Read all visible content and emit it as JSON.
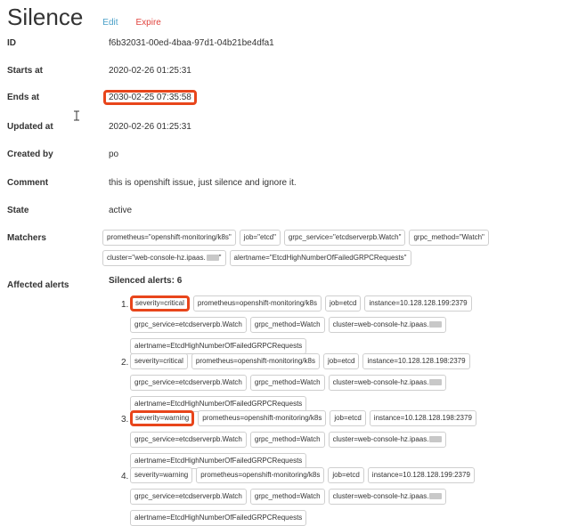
{
  "header": {
    "title": "Silence",
    "edit_label": "Edit",
    "expire_label": "Expire"
  },
  "fields": {
    "id": {
      "label": "ID",
      "value": "f6b32031-00ed-4baa-97d1-04b21be4dfa1"
    },
    "starts_at": {
      "label": "Starts at",
      "value": "2020-02-26 01:25:31"
    },
    "ends_at": {
      "label": "Ends at",
      "value": "2030-02-25 07:35:58"
    },
    "updated_at": {
      "label": "Updated at",
      "value": "2020-02-26 01:25:31"
    },
    "created_by": {
      "label": "Created by",
      "value": "po"
    },
    "comment": {
      "label": "Comment",
      "value": "this is openshift issue, just silence and ignore it."
    },
    "state": {
      "label": "State",
      "value": "active"
    },
    "matchers_label": "Matchers",
    "affected_label": "Affected alerts"
  },
  "matchers": [
    "prometheus=\"openshift-monitoring/k8s\"",
    "job=\"etcd\"",
    "grpc_service=\"etcdserverpb.Watch\"",
    "grpc_method=\"Watch\"",
    "cluster=\"web-console-hz.ipaas.",
    "alertname=\"EtcdHighNumberOfFailedGRPCRequests\""
  ],
  "silenced_title": "Silenced alerts: 6",
  "alerts": [
    {
      "num": "1.",
      "labels": [
        "severity=critical",
        "prometheus=openshift-monitoring/k8s",
        "job=etcd",
        "instance=10.128.128.199:2379",
        "grpc_service=etcdserverpb.Watch",
        "grpc_method=Watch",
        "cluster=web-console-hz.ipaas.",
        "alertname=EtcdHighNumberOfFailedGRPCRequests"
      ]
    },
    {
      "num": "2.",
      "labels": [
        "severity=critical",
        "prometheus=openshift-monitoring/k8s",
        "job=etcd",
        "instance=10.128.128.198:2379",
        "grpc_service=etcdserverpb.Watch",
        "grpc_method=Watch",
        "cluster=web-console-hz.ipaas.",
        "alertname=EtcdHighNumberOfFailedGRPCRequests"
      ]
    },
    {
      "num": "3.",
      "labels": [
        "severity=warning",
        "prometheus=openshift-monitoring/k8s",
        "job=etcd",
        "instance=10.128.128.198:2379",
        "grpc_service=etcdserverpb.Watch",
        "grpc_method=Watch",
        "cluster=web-console-hz.ipaas.",
        "alertname=EtcdHighNumberOfFailedGRPCRequests"
      ]
    },
    {
      "num": "4.",
      "labels": [
        "severity=warning",
        "prometheus=openshift-monitoring/k8s",
        "job=etcd",
        "instance=10.128.128.199:2379",
        "grpc_service=etcdserverpb.Watch",
        "grpc_method=Watch",
        "cluster=web-console-hz.ipaas.",
        "alertname=EtcdHighNumberOfFailedGRPCRequests"
      ]
    }
  ],
  "colors": {
    "highlight": "#e8451b",
    "edit_link": "#4aa0c8",
    "expire_link": "#e0443e"
  }
}
